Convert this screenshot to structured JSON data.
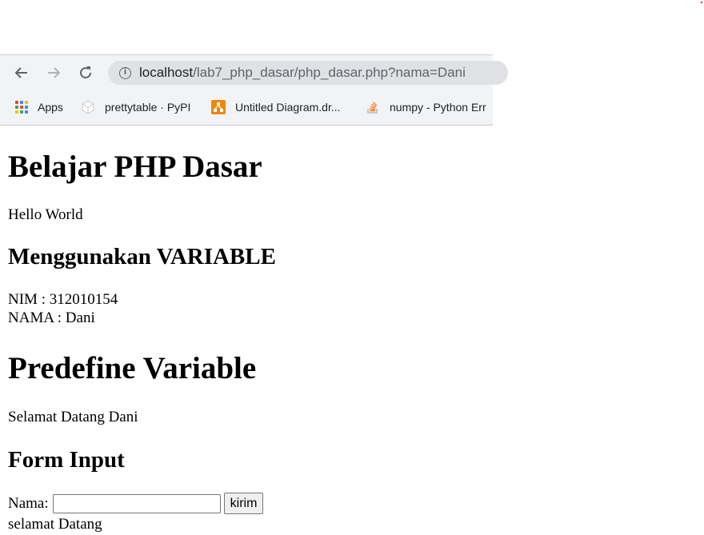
{
  "browser": {
    "url_host": "localhost",
    "url_rest": "/lab7_php_dasar/php_dasar.php?nama=Dani",
    "bookmarks": [
      {
        "label": "Apps",
        "icon": "apps-grid-icon"
      },
      {
        "label": "prettytable · PyPI",
        "icon": "pypi-cube-icon"
      },
      {
        "label": "Untitled Diagram.dr...",
        "icon": "drawio-icon"
      },
      {
        "label": "numpy - Python Err",
        "icon": "stackoverflow-icon"
      }
    ]
  },
  "page": {
    "heading_main": "Belajar PHP Dasar",
    "hello": "Hello World",
    "heading_variable": "Menggunakan VARIABLE",
    "nim_line": "NIM : 312010154",
    "nama_line": "NAMA : Dani",
    "heading_predefine": "Predefine Variable",
    "welcome": "Selamat Datang Dani",
    "heading_form": "Form Input",
    "form_label": "Nama:",
    "input_value": "",
    "submit_label": "kirim",
    "result_text": "selamat Datang"
  },
  "colors": {
    "chrome_bg": "#f1f3f4",
    "omnibox_bg": "#dfe1e5",
    "drawio_orange": "#f08705"
  }
}
